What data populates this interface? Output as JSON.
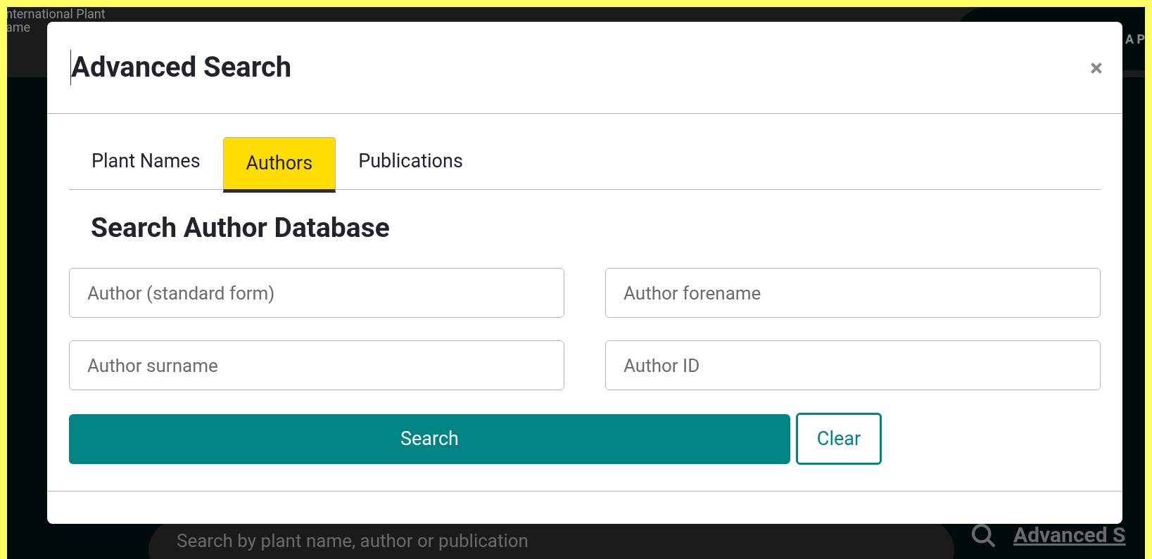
{
  "background": {
    "header_lines": [
      "nternational Plant",
      "ame"
    ],
    "header_right": "A P",
    "search": {
      "placeholder": "Search by plant name, author or publication"
    },
    "advanced_link": "Advanced S"
  },
  "dialog": {
    "title": "Advanced Search",
    "close": "×",
    "tabs": [
      {
        "label": "Plant Names",
        "selected": false
      },
      {
        "label": "Authors",
        "selected": true
      },
      {
        "label": "Publications",
        "selected": false
      }
    ],
    "heading": "Search Author Database",
    "fields": [
      {
        "placeholder": "Author (standard form)"
      },
      {
        "placeholder": "Author forename"
      },
      {
        "placeholder": "Author surname"
      },
      {
        "placeholder": "Author ID"
      }
    ],
    "buttons": [
      {
        "label": "Search",
        "kind": "primary"
      },
      {
        "label": "Clear",
        "kind": "outline"
      }
    ]
  }
}
